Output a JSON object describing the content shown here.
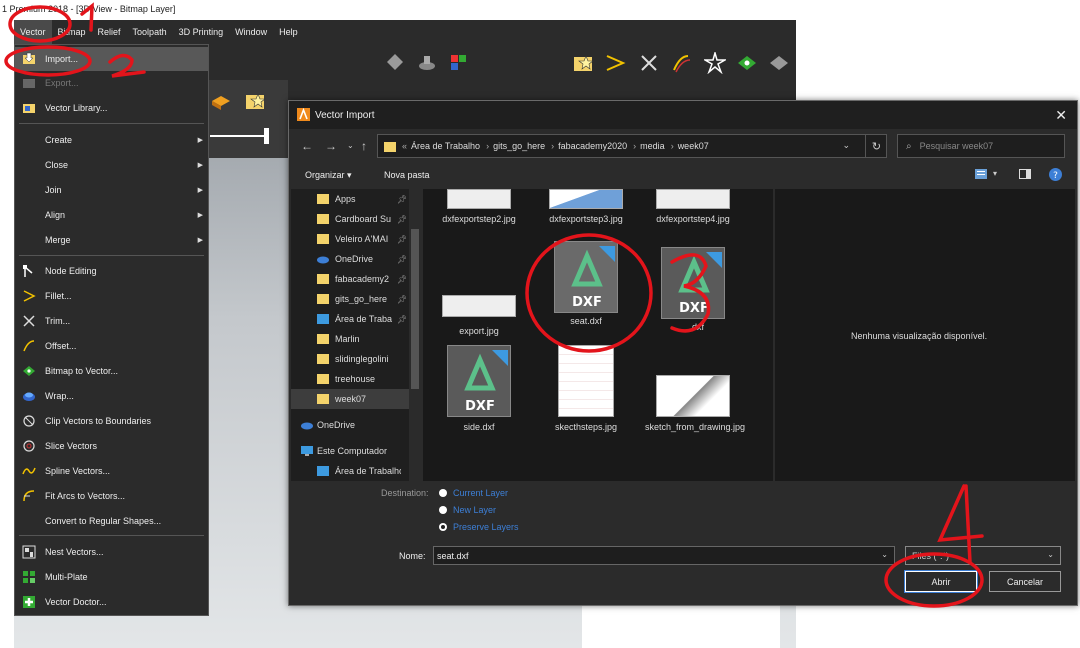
{
  "app": {
    "title": "1 Premium 2018 - [3D View - Bitmap Layer]",
    "menubar": [
      "Vector",
      "Bitmap",
      "Relief",
      "Toolpath",
      "3D Printing",
      "Window",
      "Help"
    ]
  },
  "vector_menu": {
    "items": [
      {
        "label": "Import...",
        "icon": "import-icon",
        "highlight": true
      },
      {
        "label": "Export...",
        "icon": "export-icon",
        "disabled": true
      },
      {
        "label": "Vector Library...",
        "icon": "vector-library-icon"
      },
      {
        "label": "Create",
        "submenu": true
      },
      {
        "label": "Close",
        "submenu": true
      },
      {
        "label": "Join",
        "submenu": true
      },
      {
        "label": "Align",
        "submenu": true
      },
      {
        "label": "Merge",
        "submenu": true
      },
      {
        "label": "Node Editing",
        "icon": "node-editing-icon"
      },
      {
        "label": "Fillet...",
        "icon": "fillet-icon"
      },
      {
        "label": "Trim...",
        "icon": "trim-icon"
      },
      {
        "label": "Offset...",
        "icon": "offset-icon"
      },
      {
        "label": "Bitmap to Vector...",
        "icon": "bitmap-to-vector-icon"
      },
      {
        "label": "Wrap...",
        "icon": "wrap-icon"
      },
      {
        "label": "Clip Vectors to Boundaries",
        "icon": "clip-vectors-icon"
      },
      {
        "label": "Slice Vectors",
        "icon": "slice-vectors-icon"
      },
      {
        "label": "Spline Vectors...",
        "icon": "spline-vectors-icon"
      },
      {
        "label": "Fit Arcs to Vectors...",
        "icon": "fit-arcs-icon"
      },
      {
        "label": "Convert to Regular Shapes..."
      },
      {
        "label": "Nest Vectors...",
        "icon": "nest-vectors-icon"
      },
      {
        "label": "Multi-Plate",
        "icon": "multi-plate-icon"
      },
      {
        "label": "Vector Doctor...",
        "icon": "vector-doctor-icon"
      }
    ]
  },
  "dialog": {
    "title": "Vector Import",
    "breadcrumb": [
      "Área de Trabalho",
      "gits_go_here",
      "fabacademy2020",
      "media",
      "week07"
    ],
    "search_placeholder": "Pesquisar week07",
    "organize": "Organizar ▾",
    "new_folder": "Nova pasta",
    "nav_items": [
      {
        "label": "Apps",
        "pin": true
      },
      {
        "label": "Cardboard Su",
        "pin": true
      },
      {
        "label": "Veleiro A'MAI",
        "pin": true
      },
      {
        "label": "OneDrive",
        "pin": true,
        "cloud": true
      },
      {
        "label": "fabacademy2",
        "pin": true
      },
      {
        "label": "gits_go_here",
        "pin": true
      },
      {
        "label": "Área de Traba",
        "pin": true,
        "blue": true
      },
      {
        "label": "Marlin"
      },
      {
        "label": "slidinglegolini"
      },
      {
        "label": "treehouse"
      },
      {
        "label": "week07",
        "selected": true
      }
    ],
    "nav_onedrive": "OneDrive",
    "nav_computer": "Este Computador",
    "nav_desktop": "Área de Trabalho",
    "files": [
      {
        "name": "dxfexportstep2.jpg",
        "kind": "img"
      },
      {
        "name": "dxfexportstep3.jpg",
        "kind": "img"
      },
      {
        "name": "dxfexportstep4.jpg",
        "kind": "img"
      },
      {
        "name": "export.jpg",
        "kind": "img"
      },
      {
        "name": "seat.dxf",
        "kind": "dxf",
        "selected": true
      },
      {
        "name": "   .dxf",
        "kind": "dxf"
      },
      {
        "name": "side.dxf",
        "kind": "dxf"
      },
      {
        "name": "skecthsteps.jpg",
        "kind": "img"
      },
      {
        "name": "sketch_from_drawing.jpg",
        "kind": "img"
      }
    ],
    "dxf_label": "DXF",
    "preview_text": "Nenhuma visualização disponível.",
    "destination_label": "Destination:",
    "destination_options": [
      {
        "label": "Current Layer",
        "checked": false
      },
      {
        "label": "New Layer",
        "checked": false
      },
      {
        "label": "Preserve Layers",
        "checked": true
      }
    ],
    "name_label": "Nome:",
    "name_value": "seat.dxf",
    "file_type": "Files (*.*)",
    "open_button": "Abrir",
    "cancel_button": "Cancelar"
  },
  "annotations": [
    "1",
    "2",
    "3",
    "4"
  ],
  "colors": {
    "annotation": "#e3141b",
    "accent": "#3d7fd6",
    "dark_bg": "#2b2b2b"
  }
}
